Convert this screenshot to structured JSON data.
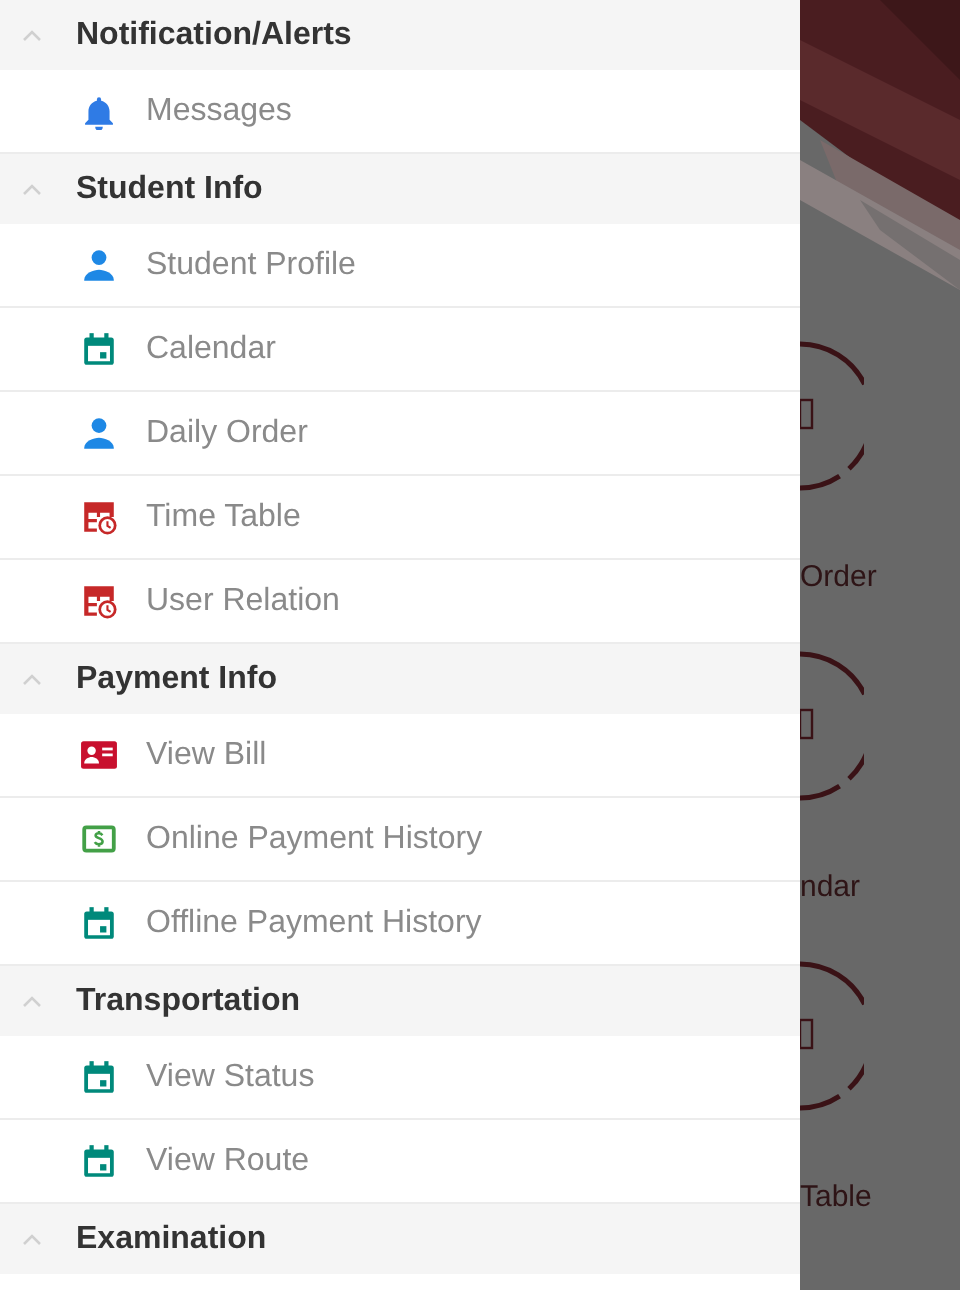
{
  "drawer": {
    "sections": [
      {
        "title": "Notification/Alerts",
        "expanded": true,
        "items": [
          {
            "label": "Messages",
            "kind": "bell"
          }
        ]
      },
      {
        "title": "Student Info",
        "expanded": true,
        "items": [
          {
            "label": "Student Profile",
            "kind": "person"
          },
          {
            "label": "Calendar",
            "kind": "calendar"
          },
          {
            "label": "Daily Order",
            "kind": "person"
          },
          {
            "label": "Time Table",
            "kind": "timetable"
          },
          {
            "label": "User Relation",
            "kind": "timetable"
          }
        ]
      },
      {
        "title": "Payment Info",
        "expanded": true,
        "items": [
          {
            "label": "View Bill",
            "kind": "card"
          },
          {
            "label": "Online Payment History",
            "kind": "money"
          },
          {
            "label": "Offline Payment History",
            "kind": "calendar"
          }
        ]
      },
      {
        "title": "Transportation",
        "expanded": true,
        "items": [
          {
            "label": "View Status",
            "kind": "calendar"
          },
          {
            "label": "View Route",
            "kind": "calendar"
          }
        ]
      },
      {
        "title": "Examination",
        "expanded": true
      }
    ]
  },
  "background": {
    "tiles": [
      {
        "label": "Order"
      },
      {
        "label": "ndar"
      },
      {
        "label": "Table"
      }
    ]
  }
}
